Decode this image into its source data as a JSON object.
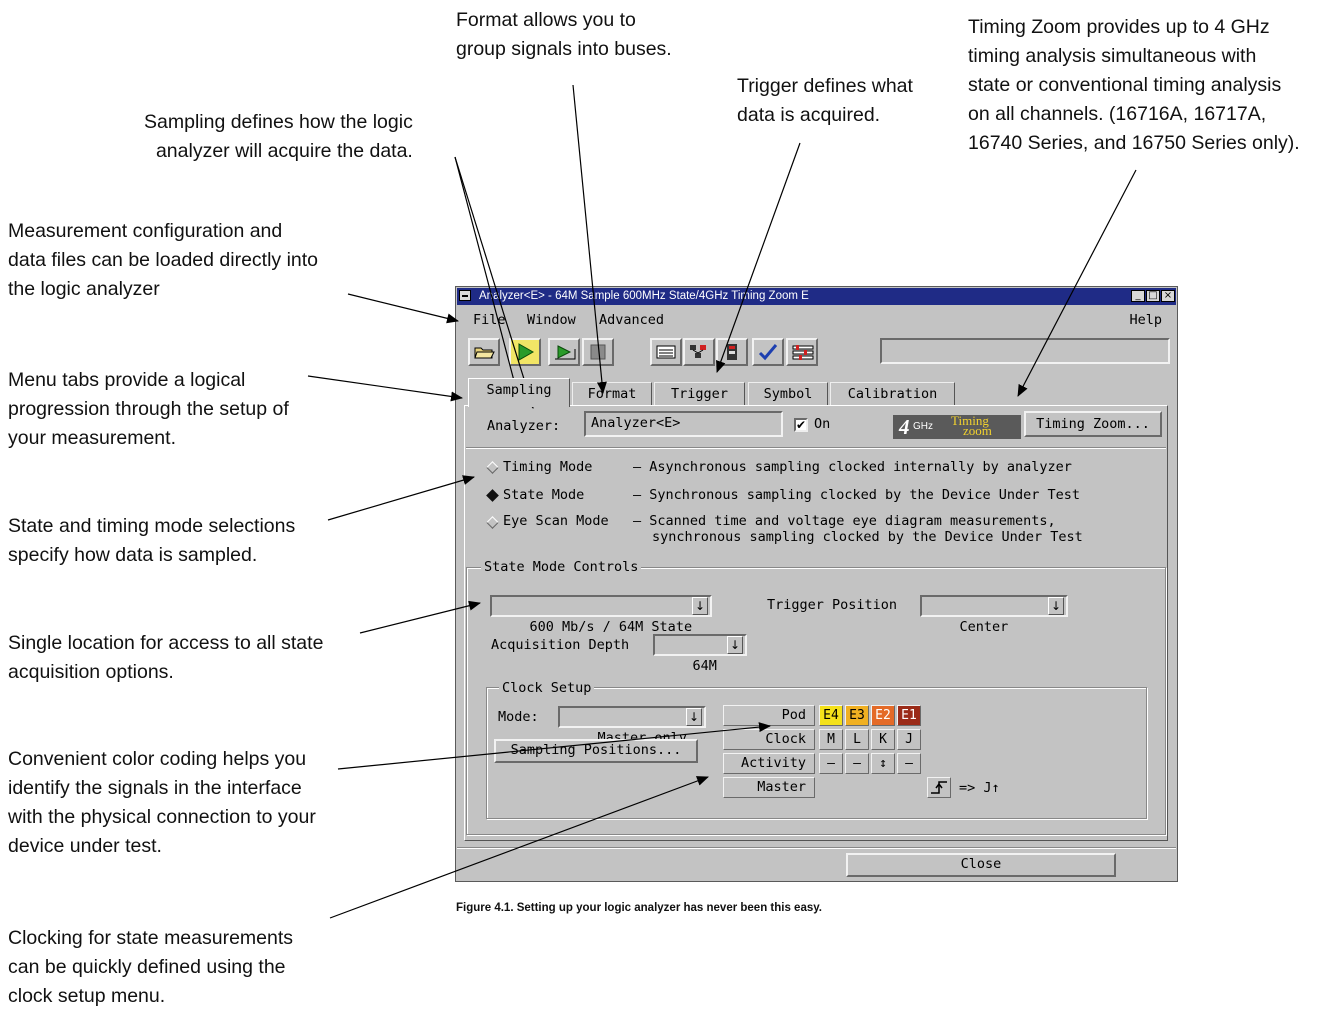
{
  "annotations": {
    "format": "Format allows you to\ngroup signals into buses.",
    "timing_zoom": "Timing Zoom provides up to 4 GHz\ntiming analysis simultaneous with\nstate or conventional timing analysis\non all channels. (16716A, 16717A,\n16740 Series, and 16750 Series only).",
    "trigger": "Trigger defines what\ndata is acquired.",
    "sampling": "Sampling defines how the logic\nanalyzer will acquire the data.",
    "measurement": "Measurement configuration and\ndata files can be loaded directly into\nthe logic analyzer",
    "menu_tabs": "Menu tabs provide a logical\nprogression through the setup of\nyour measurement.",
    "modes": "State and timing mode selections\nspecify how data is sampled.",
    "single_location": "Single location for access to all state\nacquisition options.",
    "color_coding": "Convenient color coding helps you\nidentify the signals in the interface\nwith the physical connection to your\ndevice under test.",
    "clocking": "Clocking for state measurements\ncan be quickly defined using the\nclock setup menu."
  },
  "caption": "Figure 4.1. Setting up your logic analyzer has never been this easy.",
  "window": {
    "title": "Analyzer<E> - 64M Sample 600MHz State/4GHz Timing Zoom E",
    "controls": [
      "_",
      "□",
      "×"
    ],
    "menus": {
      "file": "File",
      "window": "Window",
      "advanced": "Advanced",
      "help": "Help"
    },
    "tabs": [
      "Sampling",
      "Format",
      "Trigger",
      "Symbol",
      "Calibration"
    ],
    "analyzer_label": "Analyzer:",
    "analyzer_value": "Analyzer<E>",
    "on_check": "✔",
    "on_label": "On",
    "logo_4": "4",
    "logo_ghz": "GHz",
    "logo_timing": "Timing",
    "logo_zoom": "zoom",
    "timing_zoom_button": "Timing Zoom...",
    "modes": [
      {
        "name": "Timing Mode",
        "desc": "– Asynchronous sampling clocked internally by analyzer"
      },
      {
        "name": "State Mode",
        "desc": "– Synchronous sampling clocked by the Device Under Test"
      },
      {
        "name": "Eye Scan Mode",
        "desc": "– Scanned time and voltage eye diagram measurements,",
        "desc2": "synchronous sampling clocked by the Device Under Test"
      }
    ],
    "state_mode_controls": "State Mode Controls",
    "state_select": "600 Mb/s / 64M State",
    "trigger_position_label": "Trigger Position",
    "trigger_position_value": "Center",
    "acq_depth_label": "Acquisition Depth",
    "acq_depth_value": "64M",
    "clock_setup": "Clock Setup",
    "mode_label": "Mode:",
    "mode_value": "Master only",
    "sampling_positions": "Sampling Positions...",
    "dropdown_arrow": "↓",
    "table": {
      "rows": [
        "Pod",
        "Clock",
        "Activity",
        "Master"
      ],
      "pods": [
        "E4",
        "E3",
        "E2",
        "E1"
      ],
      "pod_colors": [
        "#f4e11a",
        "#f0b022",
        "#e46a27",
        "#9b2b18"
      ],
      "clocks": [
        "M",
        "L",
        "K",
        "J"
      ],
      "activity": [
        "–",
        "–",
        "↕",
        "–"
      ],
      "master_edge": "↑̲",
      "master_result": "=> J↑"
    },
    "close_button": "Close"
  }
}
